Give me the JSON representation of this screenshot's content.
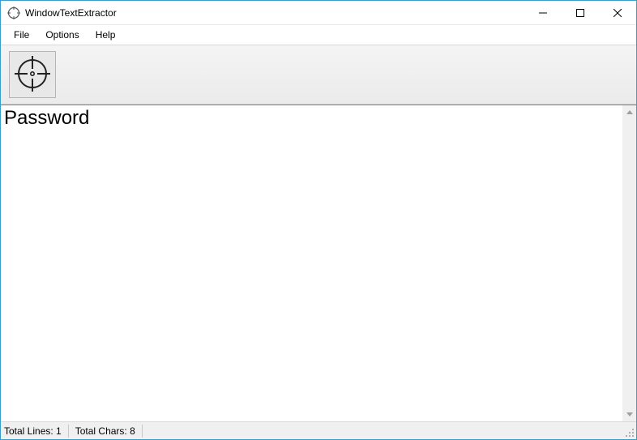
{
  "window": {
    "title": "WindowTextExtractor"
  },
  "menu": {
    "file": "File",
    "options": "Options",
    "help": "Help"
  },
  "content": {
    "extracted_text": "Password"
  },
  "status": {
    "total_lines_label": "Total Lines:",
    "total_lines_value": "1",
    "total_chars_label": "Total Chars:",
    "total_chars_value": "8"
  }
}
